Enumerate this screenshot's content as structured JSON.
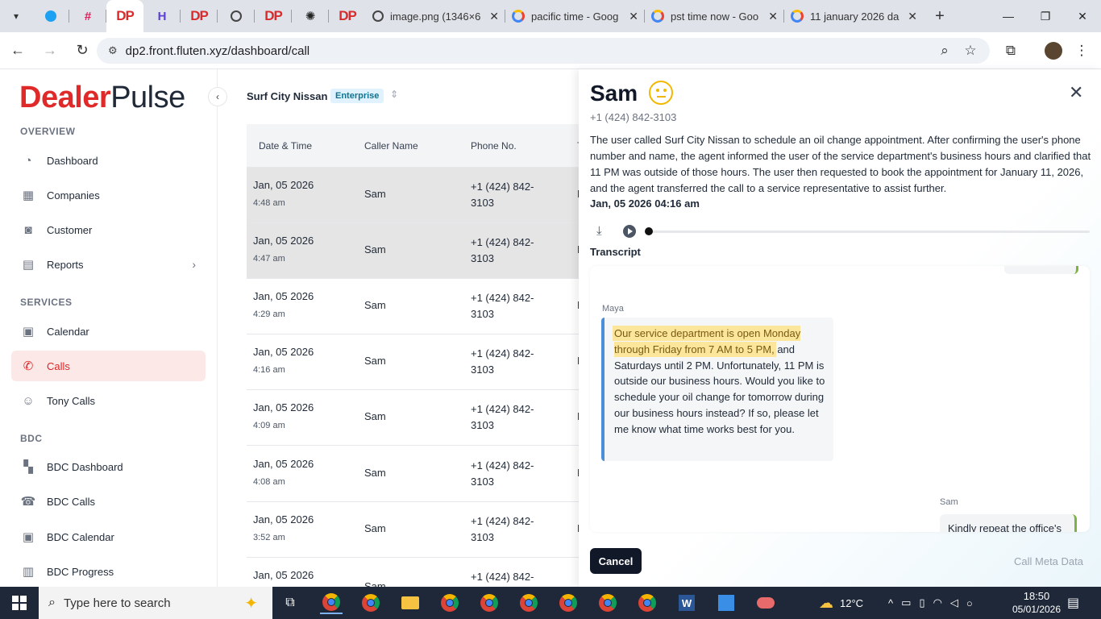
{
  "browser": {
    "tabs": [
      {
        "title": "image.png (1346×6"
      },
      {
        "title": "pacific time - Goog"
      },
      {
        "title": "pst time now - Goo"
      },
      {
        "title": "11 january 2026 da"
      }
    ],
    "url": "dp2.front.fluten.xyz/dashboard/call"
  },
  "sidebar": {
    "logo_part1": "Dealer",
    "logo_part2": "Pulse",
    "sections": {
      "overview": "OVERVIEW",
      "services": "SERVICES",
      "bdc": "BDC"
    },
    "items": {
      "dashboard": "Dashboard",
      "companies": "Companies",
      "customer": "Customer",
      "reports": "Reports",
      "calendar": "Calendar",
      "calls": "Calls",
      "tony_calls": "Tony Calls",
      "bdc_dashboard": "BDC Dashboard",
      "bdc_calls": "BDC Calls",
      "bdc_calendar": "BDC Calendar",
      "bdc_progress": "BDC Progress"
    }
  },
  "main": {
    "dealer": "Surf City Nissan",
    "plan_badge": "Enterprise",
    "columns": {
      "date": "Date & Time",
      "caller": "Caller Name",
      "phone": "Phone No.",
      "extra": "T"
    },
    "rows": [
      {
        "date": "Jan, 05 2026",
        "time": "4:48 am",
        "name": "Sam",
        "phone": "+1 (424) 842-3103",
        "cut": "N"
      },
      {
        "date": "Jan, 05 2026",
        "time": "4:47 am",
        "name": "Sam",
        "phone": "+1 (424) 842-3103",
        "cut": "N"
      },
      {
        "date": "Jan, 05 2026",
        "time": "4:29 am",
        "name": "Sam",
        "phone": "+1 (424) 842-3103",
        "cut": "N"
      },
      {
        "date": "Jan, 05 2026",
        "time": "4:16 am",
        "name": "Sam",
        "phone": "+1 (424) 842-3103",
        "cut": "N"
      },
      {
        "date": "Jan, 05 2026",
        "time": "4:09 am",
        "name": "Sam",
        "phone": "+1 (424) 842-3103",
        "cut": "N"
      },
      {
        "date": "Jan, 05 2026",
        "time": "4:08 am",
        "name": "Sam",
        "phone": "+1 (424) 842-3103",
        "cut": "N"
      },
      {
        "date": "Jan, 05 2026",
        "time": "3:52 am",
        "name": "Sam",
        "phone": "+1 (424) 842-3103",
        "cut": "N"
      },
      {
        "date": "Jan, 05 2026",
        "time": "",
        "name": "Sam",
        "phone": "+1 (424) 842-",
        "cut": ""
      }
    ]
  },
  "detail": {
    "name": "Sam",
    "phone": "+1 (424) 842-3103",
    "summary": "The user called Surf City Nissan to schedule an oil change appointment. After confirming the user's phone number and name, the agent informed the user of the service department's business hours and clarified that 11 PM was outside of those hours. The user then requested to book the appointment for January 11, 2026, and the agent transferred the call to a service representative to assist further.",
    "datetime": "Jan, 05 2026 04:16 am",
    "transcript_label": "Transcript",
    "messages": {
      "maya_speaker": "Maya",
      "maya_highlight": "Our service department is open Monday through Friday from 7 AM to 5 PM,",
      "maya_rest": " and Saturdays until 2 PM. Unfortunately, 11 PM is outside our business hours. Would you like to schedule your oil change for tomorrow during our business hours instead? If so, please let me know what time works best for you.",
      "sam_speaker": "Sam",
      "sam_text": "Kindly repeat the office's"
    },
    "cancel_label": "Cancel",
    "meta_label": "Call Meta Data"
  },
  "taskbar": {
    "search_placeholder": "Type here to search",
    "temperature": "12°C",
    "time": "18:50",
    "date": "05/01/2026"
  }
}
